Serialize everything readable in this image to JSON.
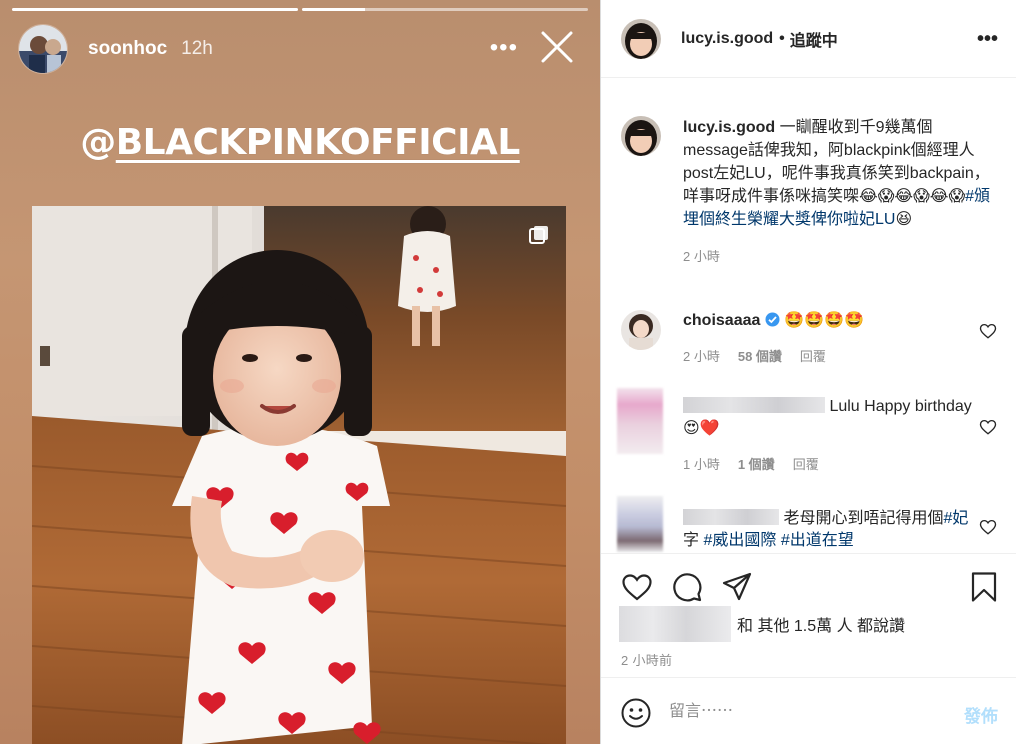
{
  "story": {
    "username": "soonhoc",
    "time": "12h",
    "more_label": "•••",
    "mention_at": "@",
    "mention_rest": "BLACKPINKOFFICIAL",
    "progress": [
      1,
      0.22
    ]
  },
  "post": {
    "author": "lucy.is.good",
    "dot": "•",
    "follow_status": "追蹤中",
    "more_label": "•••",
    "caption": {
      "username": "lucy.is.good",
      "text": " 一瞓醒收到千9幾萬個message話俾我知，阿blackpink個經理人post左妃LU，呢件事我真係笑到backpain，咩事呀成件事係咪搞笑㗎😂😱😂😱😂😱",
      "hashtag": "#頒埋個終生榮耀大獎俾你啦妃LU",
      "end_emoji": "😆",
      "time": "2 小時"
    },
    "comments": [
      {
        "username": "choisaaaa",
        "verified": true,
        "text": " 🤩🤩🤩🤩",
        "time": "2 小時",
        "likes": "58 個讚",
        "reply": "回覆"
      },
      {
        "text": " Lulu Happy birthday😍❤️",
        "time": "1 小時",
        "likes": "1 個讚",
        "reply": "回覆"
      },
      {
        "text_a": "老母開心到唔記得用個",
        "tag_a": "#妃",
        "text_b": " 字 ",
        "tag_b": "#威出國際",
        "text_c": " ",
        "tag_c": "#出道在望"
      }
    ],
    "likes_text": "和 其他 1.5萬 人 都說讚",
    "posted": "2 小時前",
    "comment_placeholder": "留言⋯⋯",
    "post_button": "發佈"
  }
}
